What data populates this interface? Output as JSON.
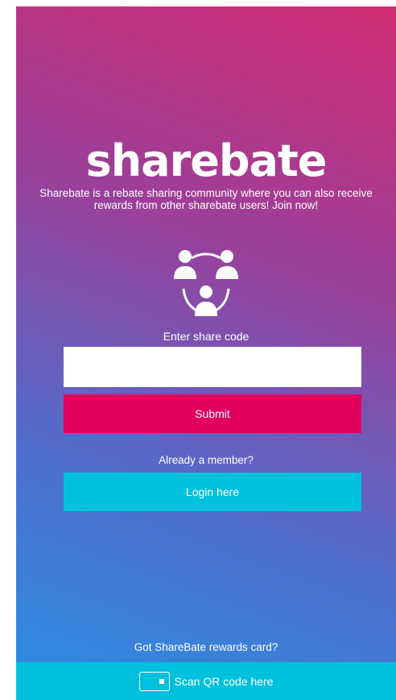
{
  "app": {
    "logo_text": "sharebate",
    "tagline": "Sharebate is a rebate sharing community where you can also receive rewards from other sharebate users! Join now!"
  },
  "share_code": {
    "label": "Enter share code",
    "value": "",
    "placeholder": "",
    "submit_label": "Submit"
  },
  "member": {
    "prompt": "Already a member?",
    "login_label": "Login here"
  },
  "rewards": {
    "prompt": "Got ShareBate rewards card?",
    "scan_label": "Scan QR code here"
  },
  "icons": {
    "community": "community-icon",
    "scan": "qr-scan-icon"
  },
  "colors": {
    "gradient_top": "#d22c74",
    "gradient_bottom": "#2a8fe2",
    "submit": "#e2005f",
    "login": "#00c1dd",
    "scan_bar": "#00c1dd"
  }
}
